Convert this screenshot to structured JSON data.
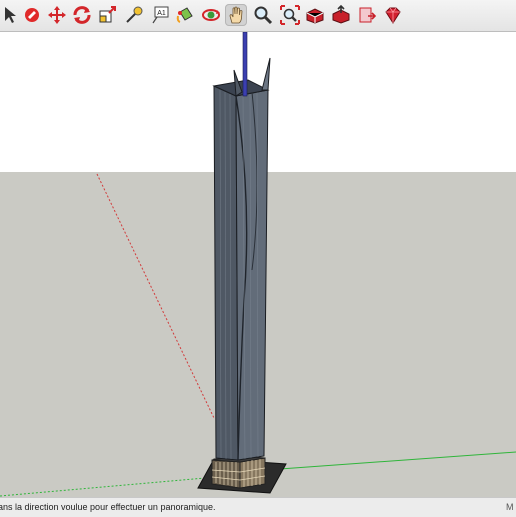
{
  "toolbar": {
    "tools": [
      {
        "name": "select-tool",
        "icon": "arrow-icon"
      },
      {
        "name": "eraser-tool",
        "icon": "eraser-icon"
      },
      {
        "name": "move-tool",
        "icon": "move-arrows-icon"
      },
      {
        "name": "rotate-tool",
        "icon": "rotate-icon"
      },
      {
        "name": "scale-tool",
        "icon": "scale-icon"
      },
      {
        "name": "tape-measure-tool",
        "icon": "tape-measure-icon"
      },
      {
        "name": "text-tool",
        "icon": "text-label-icon",
        "label": "A1"
      },
      {
        "name": "paint-bucket-tool",
        "icon": "paint-bucket-icon"
      },
      {
        "name": "orbit-tool",
        "icon": "orbit-icon"
      },
      {
        "name": "pan-tool",
        "icon": "hand-icon",
        "active": true
      },
      {
        "name": "zoom-tool",
        "icon": "magnifier-icon"
      },
      {
        "name": "zoom-extents-tool",
        "icon": "zoom-extents-icon"
      },
      {
        "name": "3d-warehouse-tool",
        "icon": "warehouse-icon"
      },
      {
        "name": "share-model-tool",
        "icon": "share-model-icon"
      },
      {
        "name": "send-to-layout-tool",
        "icon": "layout-icon"
      },
      {
        "name": "extension-warehouse-tool",
        "icon": "ruby-gem-icon"
      }
    ]
  },
  "colors": {
    "ground": "#cacac4",
    "sky": "#ffffff",
    "tower_glass": "#5b6470",
    "red_axis": "#d23a3a",
    "green_axis": "#2fb53a"
  },
  "status": {
    "hint": "ans la direction voulue pour effectuer un panoramique.",
    "right": "M"
  }
}
